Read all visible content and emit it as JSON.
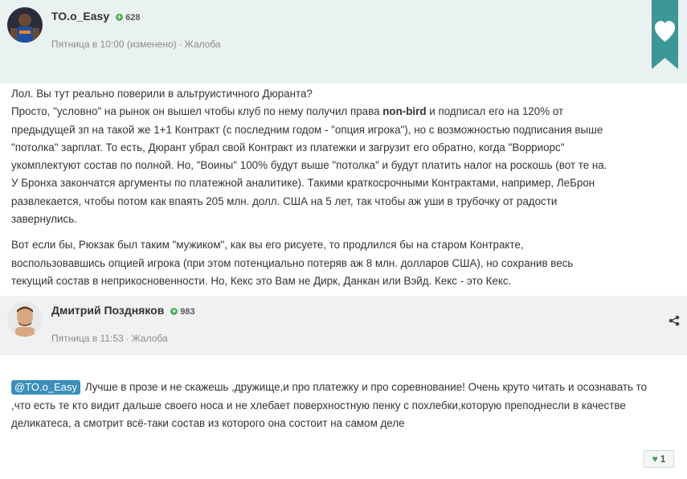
{
  "posts": [
    {
      "author": "TO.o_Easy",
      "rating": "628",
      "date": "Пятница в 10:00 (изменено)",
      "separator": "·",
      "report_label": "Жалоба",
      "body_paragraph1_lines": [
        "Лол. Вы тут реально поверили в альтруистичного Дюранта?",
        "Просто, \"условно\" на рынок он вышел чтобы клуб по нему получил права ",
        "предыдущей зп на такой же 1+1 Контракт (с последним годом - \"опция игрока\"), но с возможностью подписания выше",
        "\"потолка\" зарплат. То есть, Дюрант убрал свой Контракт из платежки и загрузит его обратно, когда \"Ворриорс\"",
        "укомплектуют состав по полной. Но, \"Воины\" 100% будут выше \"потолка\" и будут платить налог на роскошь (вот те на.",
        "У Бронха закончатся аргументы по платежной аналитике). Такими краткосрочными Контрактами, например, ЛеБрон",
        "развлекается, чтобы потом как впаять 205 млн. долл. США на 5 лет, так чтобы аж уши в трубочку от радости",
        "завернулись."
      ],
      "bold_term": "non-bird",
      "line2_suffix": " и подписал его на 120% от",
      "body_paragraph2_lines": [
        "Вот если бы, Рюкзак был таким \"мужиком\", как вы его рисуете, то продлился бы на старом Контракте,",
        "воспользовавшись опцией игрока (при этом потенциально потеряв аж 8 млн. долларов США), но сохранив весь",
        "текущий состав в неприкосновенности. Но, Кекс это Вам не Дирк, Данкан или Вэйд. Кекс - это Кекс."
      ]
    },
    {
      "author": "Дмитрий Поздняков",
      "rating": "983",
      "date": "Пятница в 11:53",
      "separator": "·",
      "report_label": "Жалоба",
      "mention": "@TO.o_Easy",
      "body_lines": [
        " Лучше в прозе и не скажешь ,дружище,и про платежку и про соревнование! Очень круто читать и осознавать то",
        ",что есть те кто видит дальше своего носа и не хлебает поверхностную пенку с похлебки,которую преподнесли в качестве",
        "деликатеса, а смотрит всё-таки состав из которого она состоит на самом деле"
      ],
      "likes": "1"
    }
  ],
  "icons": {
    "like_ribbon": "heart-icon",
    "share": "share-icon",
    "rating": "plus-circle-icon"
  },
  "colors": {
    "ribbon": "#3d9797",
    "header_bg_1": "#e9f2f1",
    "header_bg_2": "#f1f1f1",
    "mention_bg": "#3a8fbd",
    "rating_icon": "#4caf50"
  }
}
